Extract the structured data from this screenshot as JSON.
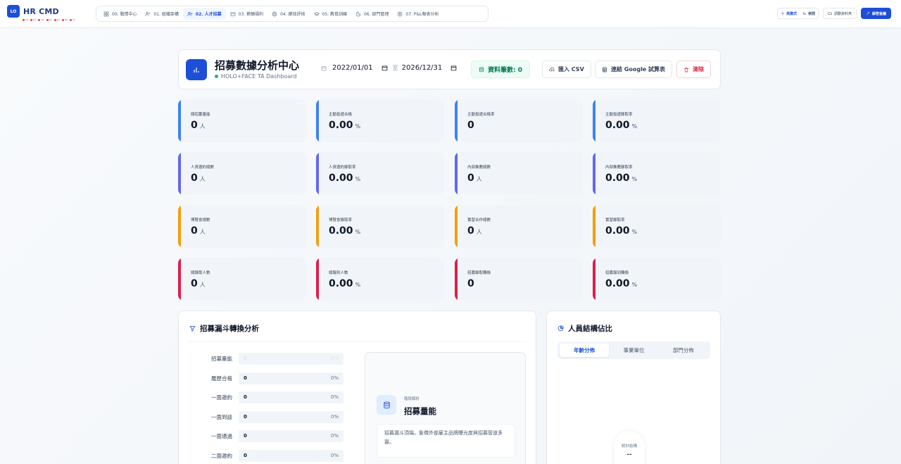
{
  "app": {
    "logo_badge": "LO",
    "name": "HR CMD",
    "tiny_tags": [
      "01",
      "02",
      "03",
      "04",
      "05",
      "06",
      "07"
    ]
  },
  "nav": {
    "tabs": [
      {
        "label": "00. 戰情中心",
        "icon": "grid-icon"
      },
      {
        "label": "01. 組織架構",
        "icon": "users-icon"
      },
      {
        "label": "02. 人才招募",
        "icon": "user-plus-icon",
        "active": true
      },
      {
        "label": "03. 薪酬福利",
        "icon": "wallet-icon"
      },
      {
        "label": "04. 績效評核",
        "icon": "target-icon"
      },
      {
        "label": "05. 教育訓練",
        "icon": "graduation-cap-icon"
      },
      {
        "label": "06. 部門管理",
        "icon": "pie-icon"
      },
      {
        "label": "07. P&L報表分析",
        "icon": "dollar-icon"
      }
    ]
  },
  "tools": {
    "light_label": "亮模式",
    "dark_label": "夜間",
    "export_label": "調動資料夾",
    "lock_label": "解密金鑰"
  },
  "header": {
    "title": "招募數據分析中心",
    "subtitle": "HOLO+FACE TA Dashboard",
    "date_from": "2022/01/01",
    "date_sep": "至",
    "date_to": "2026/12/31",
    "record_count": "資料筆數: 0",
    "import_csv": "匯入 CSV",
    "connect_sheets": "連結 Google 試算表",
    "clear": "清除"
  },
  "kpis": [
    {
      "label": "總招募量能",
      "value": "0",
      "unit": "人"
    },
    {
      "label": "主動投遞合格",
      "value": "0.00",
      "unit": "%"
    },
    {
      "label": "主動投遞合格率",
      "value": "0",
      "unit": ""
    },
    {
      "label": "主動投遞錄取率",
      "value": "0.00",
      "unit": "%"
    },
    {
      "label": "人資邀約總數",
      "value": "0",
      "unit": "人"
    },
    {
      "label": "人資邀約錄取率",
      "value": "0.00",
      "unit": "%"
    },
    {
      "label": "內部推薦總數",
      "value": "0",
      "unit": "人"
    },
    {
      "label": "內部推薦錄取率",
      "value": "0.00",
      "unit": "%"
    },
    {
      "label": "博覽會總數",
      "value": "0",
      "unit": "人"
    },
    {
      "label": "博覽會錄取率",
      "value": "0.00",
      "unit": "%"
    },
    {
      "label": "實習合作總數",
      "value": "0",
      "unit": "人"
    },
    {
      "label": "實習錄取率",
      "value": "0.00",
      "unit": "%"
    },
    {
      "label": "總錄取人數",
      "value": "0",
      "unit": "人"
    },
    {
      "label": "總報到人數",
      "value": "0.00",
      "unit": "%"
    },
    {
      "label": "招募錄取轉換",
      "value": "0",
      "unit": ""
    },
    {
      "label": "招募報到轉換",
      "value": "0.00",
      "unit": "%"
    }
  ],
  "kpi_colors": [
    "#3b82f6",
    "#6366f1",
    "#f59e0b",
    "#e11d48"
  ],
  "funnel": {
    "title": "招募漏斗轉換分析",
    "rows": [
      {
        "label": "招募量能",
        "count": "0",
        "pct": "0%",
        "fill": 0
      },
      {
        "label": "履歷合格",
        "count": "0",
        "pct": "0%",
        "fill": 0
      },
      {
        "label": "一面邀約",
        "count": "0",
        "pct": "0%",
        "fill": 0
      },
      {
        "label": "一面到談",
        "count": "0",
        "pct": "0%",
        "fill": 0
      },
      {
        "label": "一面通過",
        "count": "0",
        "pct": "0%",
        "fill": 0
      },
      {
        "label": "二面邀約",
        "count": "0",
        "pct": "0%",
        "fill": 0
      }
    ],
    "stage_kicker": "階段解析",
    "stage_title": "招募量能",
    "stage_desc": "招募漏斗頂端，象徵外部雇主品牌曝光度與招募管道多寡。"
  },
  "structure": {
    "title": "人員結構佔比",
    "tabs": [
      {
        "label": "年齡分佈",
        "active": true
      },
      {
        "label": "事業單位"
      },
      {
        "label": "部門分佈"
      }
    ],
    "center_label": "統計結構",
    "center_value": "--"
  }
}
